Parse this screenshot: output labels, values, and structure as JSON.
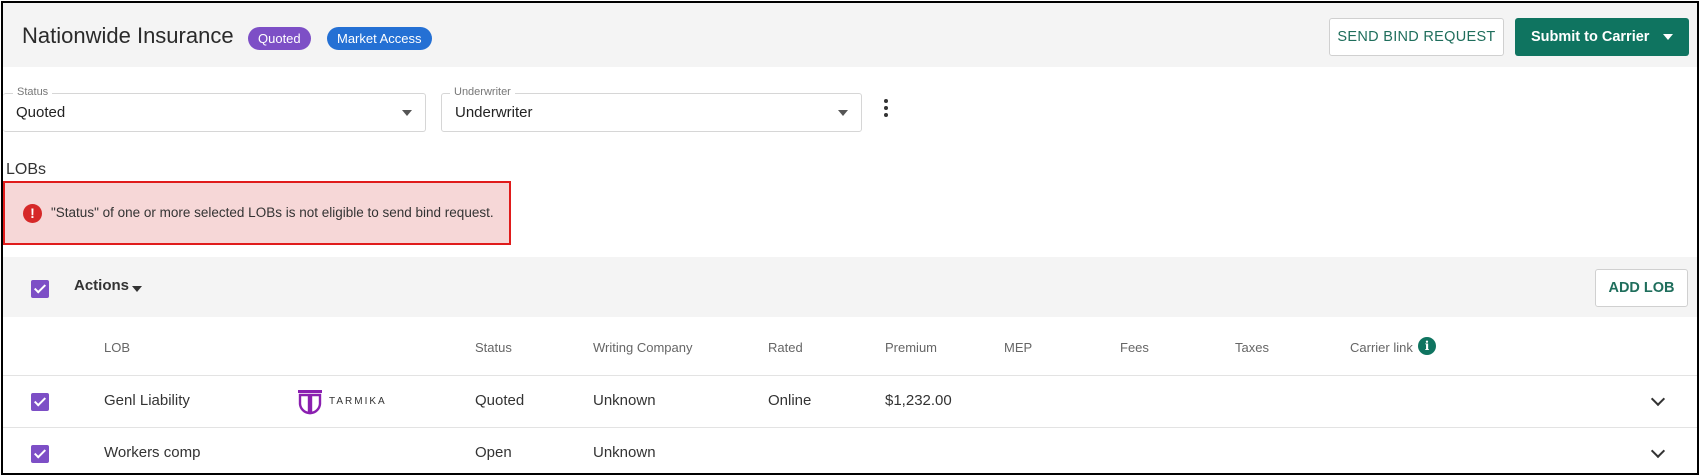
{
  "header": {
    "title": "Nationwide Insurance",
    "badges": [
      "Quoted",
      "Market Access"
    ],
    "send_bind_label": "SEND BIND REQUEST",
    "submit_label": "Submit to Carrier"
  },
  "fields": {
    "status": {
      "label": "Status",
      "value": "Quoted"
    },
    "underwriter": {
      "label": "Underwriter",
      "value": "Underwriter"
    }
  },
  "lobs": {
    "label": "LOBs",
    "alert": "\"Status\" of one or more selected LOBs is not eligible to send bind request."
  },
  "toolbar": {
    "actions_label": "Actions",
    "add_lob_label": "ADD LOB"
  },
  "table": {
    "columns": [
      "LOB",
      "Status",
      "Writing Company",
      "Rated",
      "Premium",
      "MEP",
      "Fees",
      "Taxes",
      "Carrier link"
    ],
    "rows": [
      {
        "lob": "Genl Liability",
        "carrier_logo": "TARMIKA",
        "status": "Quoted",
        "writing_company": "Unknown",
        "rated": "Online",
        "premium": "$1,232.00"
      },
      {
        "lob": "Workers comp",
        "status": "Open",
        "writing_company": "Unknown"
      }
    ]
  },
  "colors": {
    "accent_green": "#0f7460",
    "checkbox_purple": "#7d4fc6",
    "badge_quoted": "#7d4fc6",
    "badge_market": "#2470d4",
    "alert_border": "#e01b1b",
    "alert_bg": "#f6d7d7"
  },
  "icons": [
    "error-icon",
    "info-icon",
    "chevron-down-icon",
    "kebab-menu-icon",
    "checkbox-checked-icon",
    "tarmika-logo"
  ]
}
